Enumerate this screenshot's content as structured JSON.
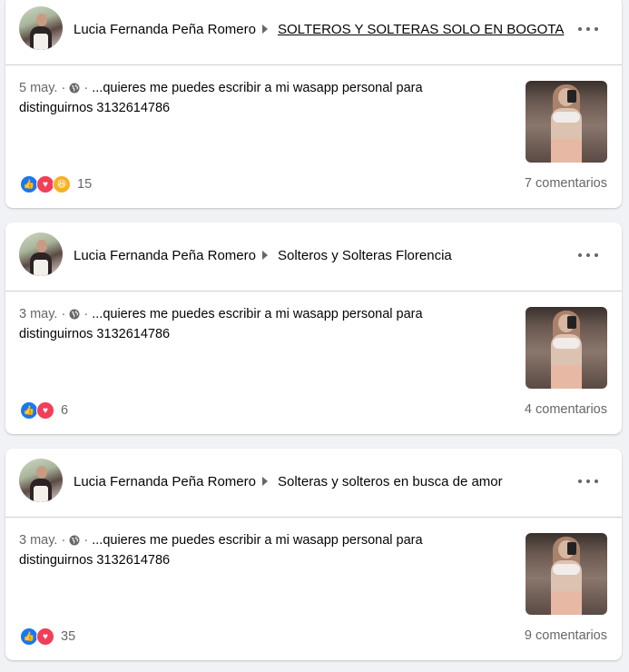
{
  "posts": [
    {
      "author": "Lucia Fernanda Peña Romero",
      "group": "SOLTEROS Y SOLTERAS SOLO EN BOGOTA",
      "date": "5 may.",
      "snippet_line1": "...quieres me puedes escribir a mi wasapp personal para",
      "snippet_line2": "distinguirnos 3132614786",
      "reaction_count": "15",
      "reactions": [
        "like",
        "love",
        "haha"
      ],
      "comments": "7 comentarios"
    },
    {
      "author": "Lucia Fernanda Peña Romero",
      "group": "Solteros y Solteras Florencia",
      "date": "3 may.",
      "snippet_line1": "...quieres me puedes escribir a mi wasapp personal para",
      "snippet_line2": "distinguirnos 3132614786",
      "reaction_count": "6",
      "reactions": [
        "like",
        "love"
      ],
      "comments": "4 comentarios"
    },
    {
      "author": "Lucia Fernanda Peña Romero",
      "group": "Solteras y solteros en busca de amor",
      "date": "3 may.",
      "snippet_line1": "...quieres me puedes escribir a mi wasapp personal para",
      "snippet_line2": "distinguirnos 3132614786",
      "reaction_count": "35",
      "reactions": [
        "like",
        "love"
      ],
      "comments": "9 comentarios"
    }
  ],
  "icons": {
    "privacy": "globe-icon",
    "more": "more-options-icon",
    "reaction_like": "like-icon",
    "reaction_love": "love-icon",
    "reaction_haha": "haha-icon"
  },
  "colors": {
    "background": "#f0f2f5",
    "card": "#ffffff",
    "secondary_text": "#65676b",
    "like": "#1877f2",
    "love": "#f33e58",
    "haha": "#f7b125"
  }
}
